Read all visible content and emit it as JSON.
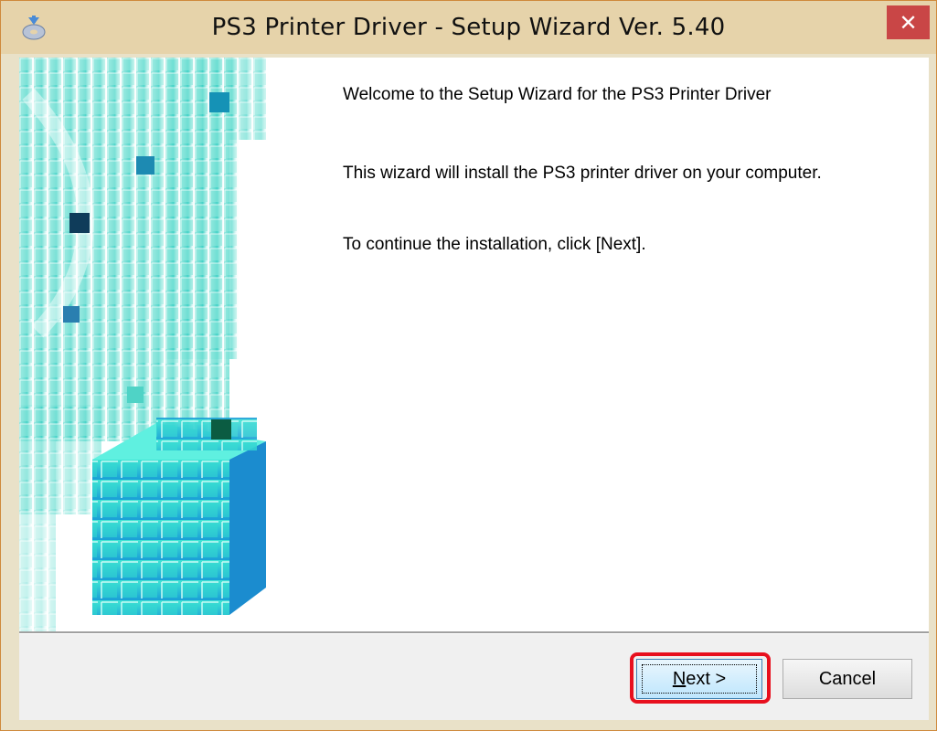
{
  "window": {
    "title": "PS3 Printer Driver - Setup Wizard Ver. 5.40",
    "close_label": "✕"
  },
  "icons": {
    "app": "installer-disc-icon",
    "close": "close-icon"
  },
  "content": {
    "welcome": "Welcome to the Setup Wizard for the PS3 Printer Driver",
    "description": "This wizard will install the PS3 printer driver on your computer.",
    "instruction": "To continue the installation, click [Next]."
  },
  "buttons": {
    "next_mnemonic": "N",
    "next_rest": "ext >",
    "cancel": "Cancel"
  },
  "colors": {
    "titlebar": "#e6d3aa",
    "close": "#c94646",
    "highlight": "#e8101e",
    "art_accent": "#1ecfc0"
  }
}
